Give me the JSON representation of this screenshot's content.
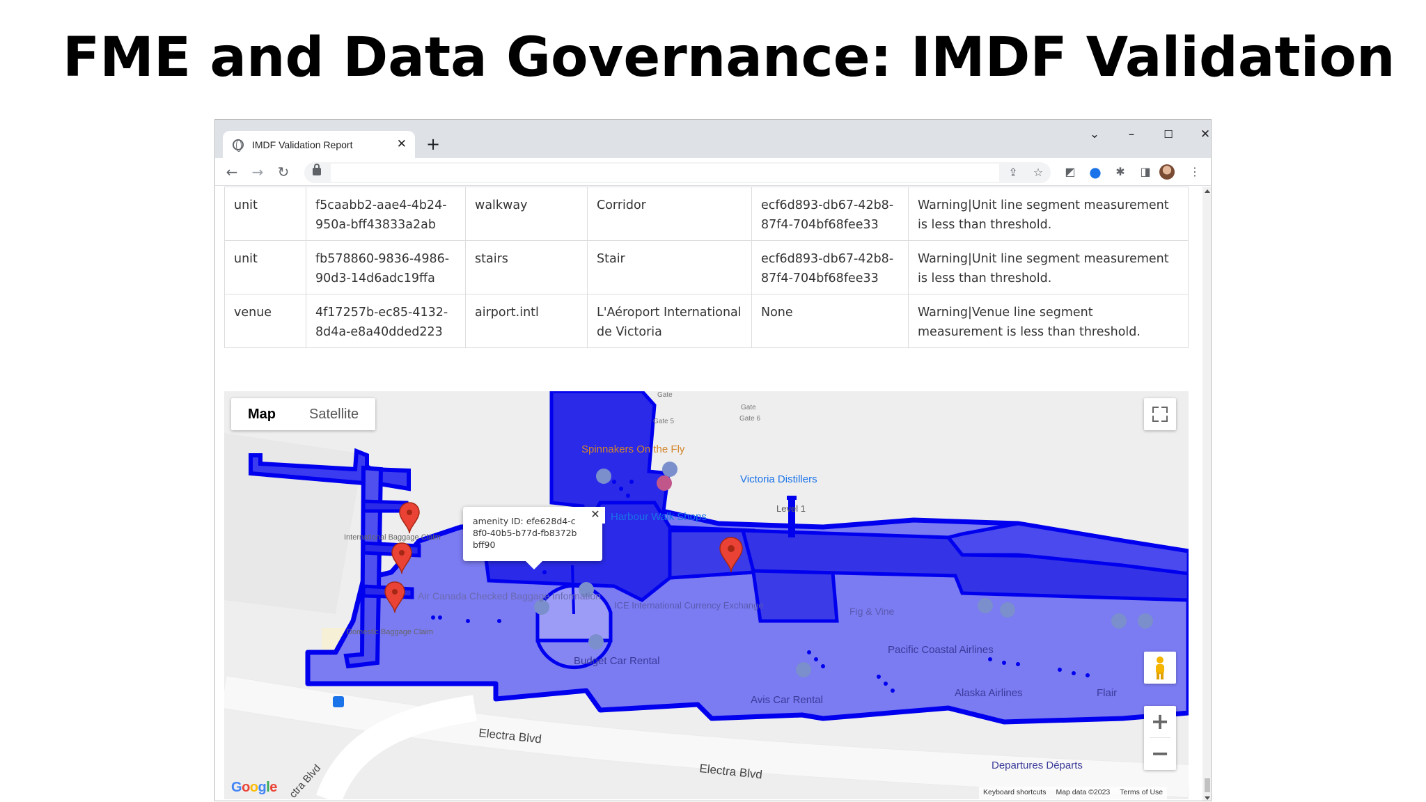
{
  "slide": {
    "title": "FME and Data Governance: IMDF Validation"
  },
  "browser": {
    "tab_title": "IMDF Validation Report",
    "tab_close": "✕",
    "new_tab": "+",
    "window_controls": {
      "dropdown": "⌄",
      "minimize": "–",
      "maximize": "☐",
      "close": "✕"
    },
    "nav": {
      "back": "←",
      "forward": "→",
      "reload": "↻"
    },
    "address_value": "",
    "omnibox_icons": [
      "share-icon",
      "bookmark-star-icon"
    ],
    "extension_icons": [
      "extension-icon",
      "blue-extension-icon",
      "puzzle-icon",
      "side-panel-icon",
      "profile-avatar",
      "kebab-menu-icon"
    ]
  },
  "table": {
    "rows": [
      {
        "type": "unit",
        "id": "f5caabb2-aae4-4b24-950a-bff43833a2ab",
        "category": "walkway",
        "name": "Corridor",
        "related_id": "ecf6d893-db67-42b8-87f4-704bf68fee33",
        "message": "Warning|Unit line segment measurement is less than threshold."
      },
      {
        "type": "unit",
        "id": "fb578860-9836-4986-90d3-14d6adc19ffa",
        "category": "stairs",
        "name": "Stair",
        "related_id": "ecf6d893-db67-42b8-87f4-704bf68fee33",
        "message": "Warning|Unit line segment measurement is less than threshold."
      },
      {
        "type": "venue",
        "id": "4f17257b-ec85-4132-8d4a-e8a40dded223",
        "category": "airport.intl",
        "name": "L'Aéroport International de Victoria",
        "related_id": "None",
        "message": "Warning|Venue line segment measurement is less than threshold."
      }
    ]
  },
  "map": {
    "type_control": {
      "map": "Map",
      "satellite": "Satellite",
      "selected": "Map"
    },
    "infowindow_text": "amenity ID: efe628d4-c8f0-40b5-b77d-fb8372bbff90",
    "infowindow_close": "✕",
    "labels": {
      "spinnakers": "Spinnakers On the Fly",
      "distillers": "Victoria Distillers",
      "harbour": "Harbour Walk Shops",
      "level": "Level 1",
      "baggage": "International Baggage Claim",
      "domestic": "Domestic Baggage Claim",
      "aircanada": "Air Canada Checked Baggage Information",
      "budget": "Budget Car Rental",
      "avis": "Avis Car Rental",
      "pacific": "Pacific Coastal Airlines",
      "alaska": "Alaska Airlines",
      "flair": "Flair",
      "departures": "Departures Départs",
      "electra1": "Electra Blvd",
      "electra2": "Electra Blvd",
      "electra3": "ctra Blvd",
      "fig": "Fig & Vine",
      "ice": "ICE International Currency Exchange",
      "gate5": "Gate 5",
      "gate6": "Gate 6",
      "gatea": "Gate",
      "gateb": "Gate"
    },
    "zoom_in": "+",
    "zoom_out": "−",
    "google_logo": "Google",
    "attribution": {
      "shortcuts": "Keyboard shortcuts",
      "data": "Map data ©2023",
      "terms": "Terms of Use"
    },
    "colors": {
      "footprint_fill": "#7b7bf2",
      "footprint_dark": "#2a2ae8",
      "outline": "#0000ee",
      "marker": "#ea4335",
      "water_blue": "#1a73e8",
      "poi_orange": "#d2852a"
    }
  }
}
